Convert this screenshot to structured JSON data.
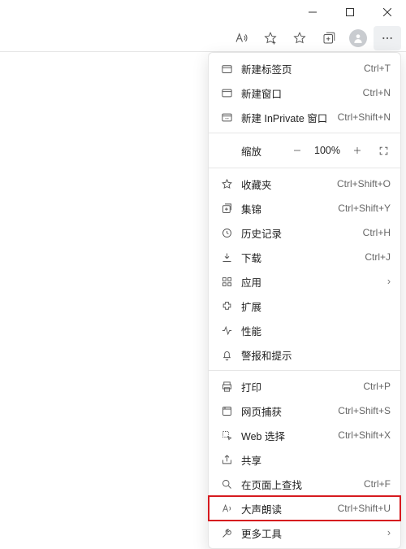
{
  "window": {
    "minimize_title": "最小化",
    "maximize_title": "最大化",
    "close_title": "关闭"
  },
  "toolbar": {
    "read_aloud_title": "大声朗读",
    "favorite_title": "将此页面添加到收藏夹",
    "favorites_hub_title": "收藏夹",
    "collections_title": "集锦",
    "profile_title": "用户配置文件",
    "more_title": "设置及更多"
  },
  "menu": {
    "new_tab": {
      "label": "新建标签页",
      "shortcut": "Ctrl+T"
    },
    "new_window": {
      "label": "新建窗口",
      "shortcut": "Ctrl+N"
    },
    "new_inprivate": {
      "label": "新建 InPrivate 窗口",
      "shortcut": "Ctrl+Shift+N"
    },
    "zoom": {
      "label": "缩放",
      "value": "100%",
      "minus_title": "缩小",
      "plus_title": "放大",
      "full_title": "全屏"
    },
    "favorites": {
      "label": "收藏夹",
      "shortcut": "Ctrl+Shift+O"
    },
    "collections": {
      "label": "集锦",
      "shortcut": "Ctrl+Shift+Y"
    },
    "history": {
      "label": "历史记录",
      "shortcut": "Ctrl+H"
    },
    "downloads": {
      "label": "下载",
      "shortcut": "Ctrl+J"
    },
    "apps": {
      "label": "应用"
    },
    "extensions": {
      "label": "扩展"
    },
    "performance": {
      "label": "性能"
    },
    "alerts": {
      "label": "警报和提示"
    },
    "print": {
      "label": "打印",
      "shortcut": "Ctrl+P"
    },
    "web_capture": {
      "label": "网页捕获",
      "shortcut": "Ctrl+Shift+S"
    },
    "web_select": {
      "label": "Web 选择",
      "shortcut": "Ctrl+Shift+X"
    },
    "share": {
      "label": "共享"
    },
    "find": {
      "label": "在页面上查找",
      "shortcut": "Ctrl+F"
    },
    "read_aloud": {
      "label": "大声朗读",
      "shortcut": "Ctrl+Shift+U"
    },
    "more_tools": {
      "label": "更多工具"
    }
  }
}
